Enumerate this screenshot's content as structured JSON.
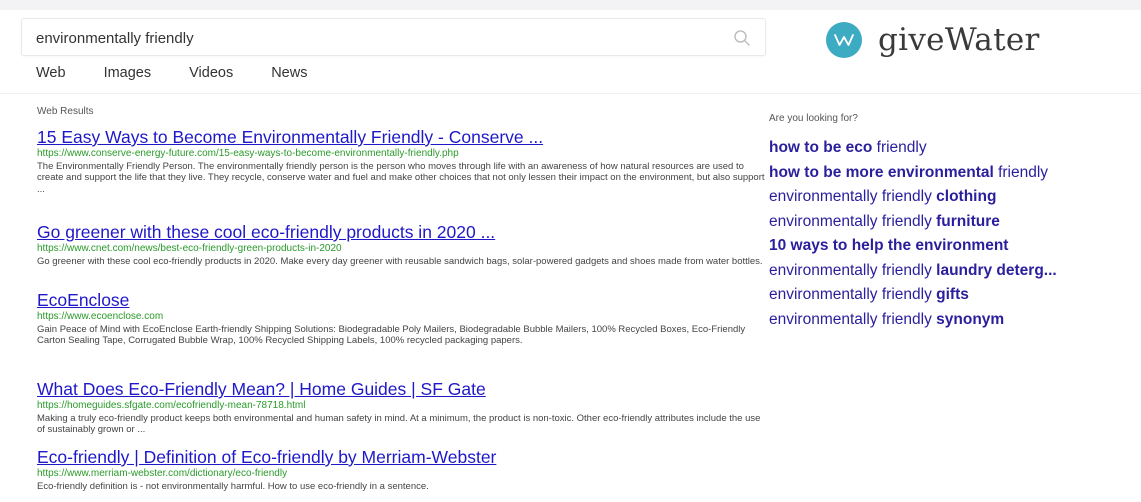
{
  "search": {
    "query": "environmentally friendly",
    "placeholder": ""
  },
  "logo": {
    "text": "giveWater",
    "mark": "W"
  },
  "tabs": [
    {
      "label": "Web"
    },
    {
      "label": "Images"
    },
    {
      "label": "Videos"
    },
    {
      "label": "News"
    }
  ],
  "results_heading": "Web Results",
  "results": [
    {
      "title": "15 Easy Ways to Become Environmentally Friendly - Conserve ...",
      "url": "https://www.conserve-energy-future.com/15-easy-ways-to-become-environmentally-friendly.php",
      "snippet": "The Environmentally Friendly Person. The environmentally friendly person is the person who moves through life with an awareness of how natural resources are used to create and support the life that they live. They recycle, conserve water and fuel and make other choices that not only lessen their impact on the environment, but also support ..."
    },
    {
      "title": "Go greener with these cool eco-friendly products in 2020 ...",
      "url": "https://www.cnet.com/news/best-eco-friendly-green-products-in-2020",
      "snippet": "Go greener with these cool eco-friendly products in 2020. Make every day greener with reusable sandwich bags, solar-powered gadgets and shoes made from water bottles."
    },
    {
      "title": "EcoEnclose",
      "url": "https://www.ecoenclose.com",
      "snippet": "Gain Peace of Mind with EcoEnclose Earth-friendly Shipping Solutions: Biodegradable Poly Mailers, Biodegradable Bubble Mailers, 100% Recycled Boxes, Eco-Friendly Carton Sealing Tape, Corrugated Bubble Wrap, 100% Recycled Shipping Labels, 100% recycled packaging papers."
    },
    {
      "title": "What Does Eco-Friendly Mean? | Home Guides | SF Gate",
      "url": "https://homeguides.sfgate.com/ecofriendly-mean-78718.html",
      "snippet": "Making a truly eco-friendly product keeps both environmental and human safety in mind. At a minimum, the product is non-toxic. Other eco-friendly attributes include the use of sustainably grown or ..."
    },
    {
      "title": "Eco-friendly | Definition of Eco-friendly by Merriam-Webster",
      "url": "https://www.merriam-webster.com/dictionary/eco-friendly",
      "snippet": "Eco-friendly definition is - not environmentally harmful. How to use eco-friendly in a sentence."
    }
  ],
  "related_heading": "Are you looking for?",
  "related": [
    {
      "before": "",
      "bold": "how to be eco",
      "after": " friendly"
    },
    {
      "before": "",
      "bold": "how to be more environmental",
      "after": " friendly"
    },
    {
      "before": "environmentally friendly ",
      "bold": "clothing",
      "after": ""
    },
    {
      "before": "environmentally friendly ",
      "bold": "furniture",
      "after": ""
    },
    {
      "before": "",
      "bold": "10 ways to help the environment",
      "after": ""
    },
    {
      "before": "environmentally friendly ",
      "bold": "laundry deterg...",
      "after": ""
    },
    {
      "before": "environmentally friendly ",
      "bold": "gifts",
      "after": ""
    },
    {
      "before": "environmentally friendly ",
      "bold": "synonym",
      "after": ""
    }
  ],
  "colors": {
    "link": "#1f18c8",
    "url": "#2a9a2a",
    "related": "#2a1e9c",
    "logo_accent": "#3dabc2"
  }
}
